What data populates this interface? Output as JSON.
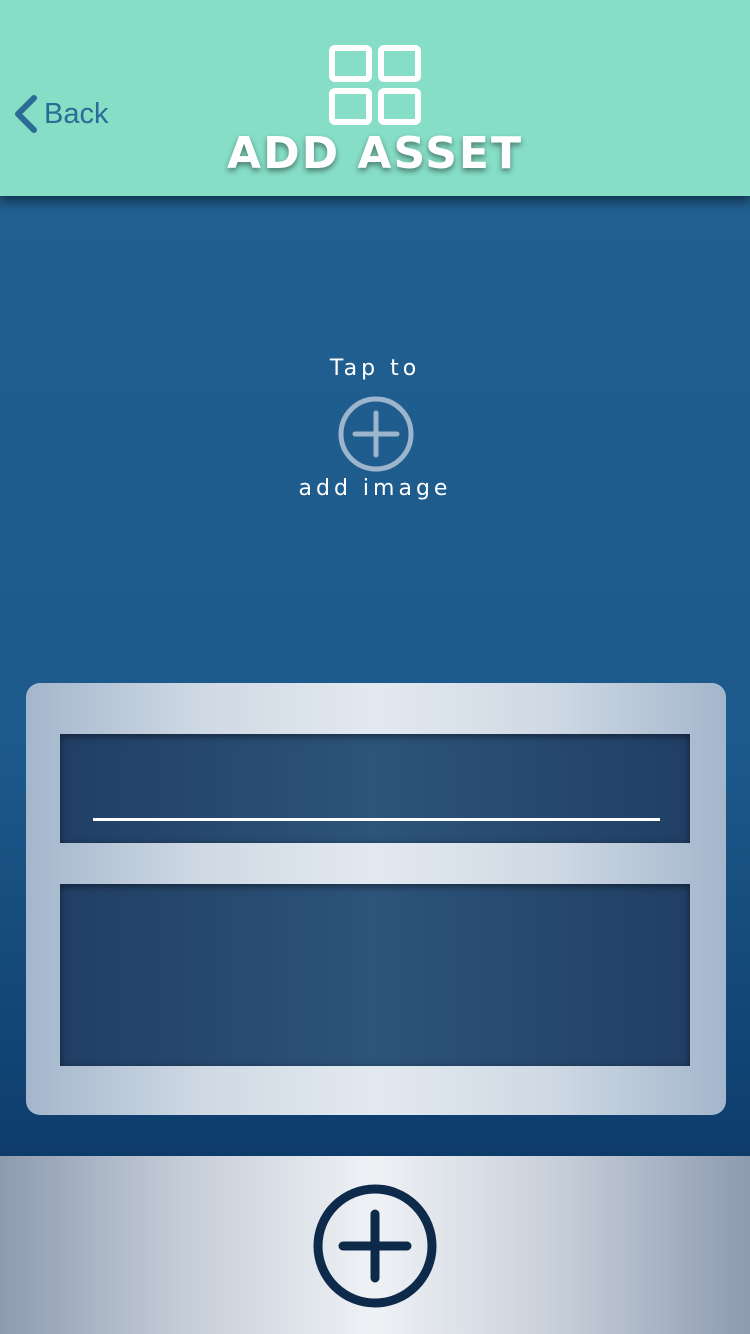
{
  "header": {
    "back_label": "Back",
    "title": "ADD ASSET",
    "icon": "grid-icon",
    "background": "#86dec6"
  },
  "image_picker": {
    "line1": "Tap to",
    "line2": "add image",
    "icon": "plus-circle-icon"
  },
  "form": {
    "name_field": {
      "value": "",
      "placeholder": ""
    },
    "description_field": {
      "value": "",
      "placeholder": ""
    }
  },
  "footer": {
    "add_button_icon": "plus-circle-icon"
  },
  "colors": {
    "accent": "#86dec6",
    "background_top": "#226192",
    "background_bottom": "#052a52",
    "field": "#2d5479",
    "button_navy": "#0d2a4a"
  }
}
